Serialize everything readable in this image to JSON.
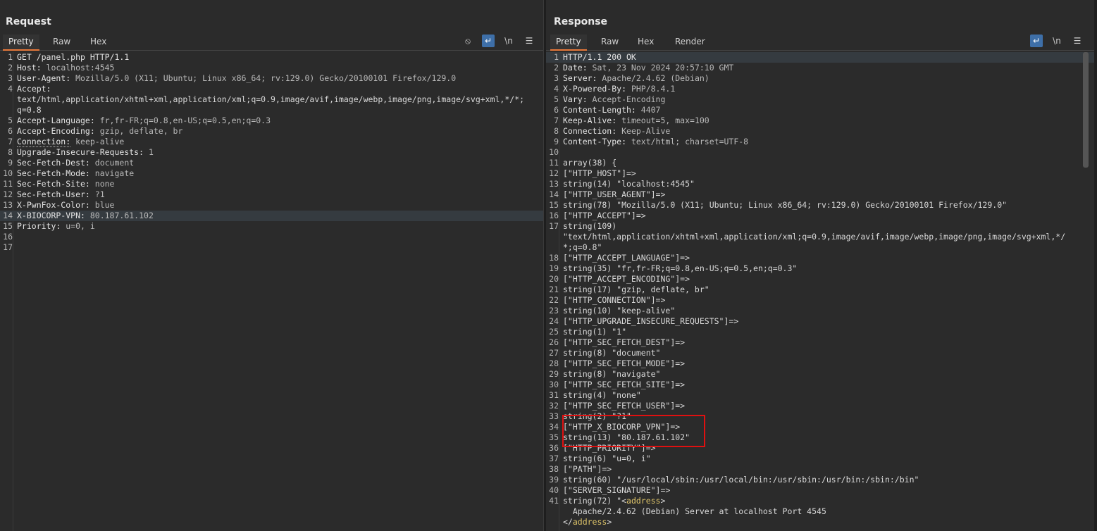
{
  "layout_buttons": [
    "columns-icon",
    "rows-icon",
    "single-icon"
  ],
  "request": {
    "title": "Request",
    "tabs": [
      "Pretty",
      "Raw",
      "Hex"
    ],
    "active_tab": "Pretty",
    "lines": [
      {
        "n": "1",
        "k": "GET /panel.php HTTP/1.1",
        "v": ""
      },
      {
        "n": "2",
        "k": "Host:",
        "v": " localhost:4545"
      },
      {
        "n": "3",
        "k": "User-Agent:",
        "v": " Mozilla/5.0 (X11; Ubuntu; Linux x86_64; rv:129.0) Gecko/20100101 Firefox/129.0"
      },
      {
        "n": "4",
        "k": "Accept:",
        "v": ""
      },
      {
        "n": "",
        "k": "",
        "v": "text/html,application/xhtml+xml,application/xml;q=0.9,image/avif,image/webp,image/png,image/svg+xml,*/*;"
      },
      {
        "n": "",
        "k": "",
        "v": "q=0.8"
      },
      {
        "n": "5",
        "k": "Accept-Language:",
        "v": " fr,fr-FR;q=0.8,en-US;q=0.5,en;q=0.3"
      },
      {
        "n": "6",
        "k": "Accept-Encoding:",
        "v": " gzip, deflate, br"
      },
      {
        "n": "7",
        "k": "Connection:",
        "v": " keep-alive"
      },
      {
        "n": "8",
        "k": "Upgrade-Insecure-Requests:",
        "v": " 1"
      },
      {
        "n": "9",
        "k": "Sec-Fetch-Dest:",
        "v": " document"
      },
      {
        "n": "10",
        "k": "Sec-Fetch-Mode:",
        "v": " navigate"
      },
      {
        "n": "11",
        "k": "Sec-Fetch-Site:",
        "v": " none"
      },
      {
        "n": "12",
        "k": "Sec-Fetch-User:",
        "v": " ?1"
      },
      {
        "n": "13",
        "k": "X-PwnFox-Color:",
        "v": " blue"
      },
      {
        "n": "14",
        "k": "X-BIOCORP-VPN:",
        "v": " 80.187.61.102"
      },
      {
        "n": "15",
        "k": "Priority:",
        "v": " u=0, i"
      },
      {
        "n": "16",
        "k": "",
        "v": ""
      },
      {
        "n": "17",
        "k": "",
        "v": ""
      }
    ]
  },
  "response": {
    "title": "Response",
    "tabs": [
      "Pretty",
      "Raw",
      "Hex",
      "Render"
    ],
    "active_tab": "Pretty",
    "lines": [
      {
        "n": "1",
        "k": "HTTP/1.1 200 OK",
        "v": ""
      },
      {
        "n": "2",
        "k": "Date:",
        "v": " Sat, 23 Nov 2024 20:57:10 GMT"
      },
      {
        "n": "3",
        "k": "Server:",
        "v": " Apache/2.4.62 (Debian)"
      },
      {
        "n": "4",
        "k": "X-Powered-By:",
        "v": " PHP/8.4.1"
      },
      {
        "n": "5",
        "k": "Vary:",
        "v": " Accept-Encoding"
      },
      {
        "n": "6",
        "k": "Content-Length:",
        "v": " 4407"
      },
      {
        "n": "7",
        "k": "Keep-Alive:",
        "v": " timeout=5, max=100"
      },
      {
        "n": "8",
        "k": "Connection:",
        "v": " Keep-Alive"
      },
      {
        "n": "9",
        "k": "Content-Type:",
        "v": " text/html; charset=UTF-8"
      },
      {
        "n": "10",
        "k": "",
        "v": ""
      },
      {
        "n": "11",
        "k": "",
        "v": "array(38) {"
      },
      {
        "n": "12",
        "k": "",
        "v": "[\"HTTP_HOST\"]=>"
      },
      {
        "n": "13",
        "k": "",
        "v": "string(14) \"localhost:4545\""
      },
      {
        "n": "14",
        "k": "",
        "v": "[\"HTTP_USER_AGENT\"]=>"
      },
      {
        "n": "15",
        "k": "",
        "v": "string(78) \"Mozilla/5.0 (X11; Ubuntu; Linux x86_64; rv:129.0) Gecko/20100101 Firefox/129.0\""
      },
      {
        "n": "16",
        "k": "",
        "v": "[\"HTTP_ACCEPT\"]=>"
      },
      {
        "n": "17",
        "k": "",
        "v": "string(109)"
      },
      {
        "n": "",
        "k": "",
        "v": "\"text/html,application/xhtml+xml,application/xml;q=0.9,image/avif,image/webp,image/png,image/svg+xml,*/"
      },
      {
        "n": "",
        "k": "",
        "v": "*;q=0.8\""
      },
      {
        "n": "18",
        "k": "",
        "v": "[\"HTTP_ACCEPT_LANGUAGE\"]=>"
      },
      {
        "n": "19",
        "k": "",
        "v": "string(35) \"fr,fr-FR;q=0.8,en-US;q=0.5,en;q=0.3\""
      },
      {
        "n": "20",
        "k": "",
        "v": "[\"HTTP_ACCEPT_ENCODING\"]=>"
      },
      {
        "n": "21",
        "k": "",
        "v": "string(17) \"gzip, deflate, br\""
      },
      {
        "n": "22",
        "k": "",
        "v": "[\"HTTP_CONNECTION\"]=>"
      },
      {
        "n": "23",
        "k": "",
        "v": "string(10) \"keep-alive\""
      },
      {
        "n": "24",
        "k": "",
        "v": "[\"HTTP_UPGRADE_INSECURE_REQUESTS\"]=>"
      },
      {
        "n": "25",
        "k": "",
        "v": "string(1) \"1\""
      },
      {
        "n": "26",
        "k": "",
        "v": "[\"HTTP_SEC_FETCH_DEST\"]=>"
      },
      {
        "n": "27",
        "k": "",
        "v": "string(8) \"document\""
      },
      {
        "n": "28",
        "k": "",
        "v": "[\"HTTP_SEC_FETCH_MODE\"]=>"
      },
      {
        "n": "29",
        "k": "",
        "v": "string(8) \"navigate\""
      },
      {
        "n": "30",
        "k": "",
        "v": "[\"HTTP_SEC_FETCH_SITE\"]=>"
      },
      {
        "n": "31",
        "k": "",
        "v": "string(4) \"none\""
      },
      {
        "n": "32",
        "k": "",
        "v": "[\"HTTP_SEC_FETCH_USER\"]=>"
      },
      {
        "n": "33",
        "k": "",
        "v": "string(2) \"?1\""
      },
      {
        "n": "34",
        "k": "",
        "v": "[\"HTTP_X_BIOCORP_VPN\"]=>"
      },
      {
        "n": "35",
        "k": "",
        "v": "string(13) \"80.187.61.102\""
      },
      {
        "n": "36",
        "k": "",
        "v": "[\"HTTP_PRIORITY\"]=>"
      },
      {
        "n": "37",
        "k": "",
        "v": "string(6) \"u=0, i\""
      },
      {
        "n": "38",
        "k": "",
        "v": "[\"PATH\"]=>"
      },
      {
        "n": "39",
        "k": "",
        "v": "string(60) \"/usr/local/sbin:/usr/local/bin:/usr/sbin:/usr/bin:/sbin:/bin\""
      },
      {
        "n": "40",
        "k": "",
        "v": "[\"SERVER_SIGNATURE\"]=>"
      },
      {
        "n": "41",
        "k": "",
        "v": "string(72) \"<address>"
      },
      {
        "n": "",
        "k": "",
        "v": "  Apache/2.4.62 (Debian) Server at localhost Port 4545"
      },
      {
        "n": "",
        "k": "",
        "v": "</address>"
      }
    ]
  },
  "icons": {
    "hide": "⦸",
    "wrap": "↵",
    "newline": "\\n",
    "menu": "☰"
  }
}
